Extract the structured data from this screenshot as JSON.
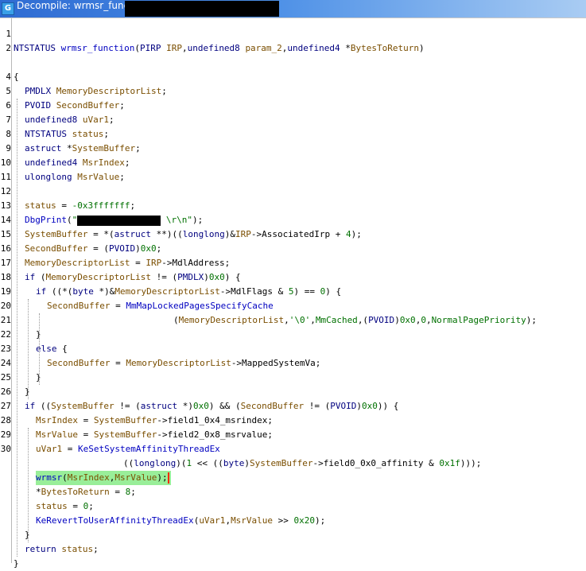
{
  "window": {
    "title": "Decompile: wrmsr_function -",
    "icon": "decompiler-icon",
    "colors": {
      "titlebar": "#2f6bd2",
      "highlight": "#99ee99",
      "keyword": "#00007f",
      "variable": "#7a4e00",
      "function": "#0000c0",
      "number": "#007000"
    }
  },
  "lines": [
    {
      "n": "1",
      "indent": 0,
      "tokens": []
    },
    {
      "n": "2",
      "indent": 0,
      "tokens": [
        [
          "t",
          "NTSTATUS"
        ],
        [
          "p",
          " "
        ],
        [
          "f",
          "wrmsr_function"
        ],
        [
          "p",
          "("
        ],
        [
          "t",
          "PIRP"
        ],
        [
          "p",
          " "
        ],
        [
          "v",
          "IRP"
        ],
        [
          "p",
          ","
        ],
        [
          "t",
          "undefined8"
        ],
        [
          "p",
          " "
        ],
        [
          "v",
          "param_2"
        ],
        [
          "p",
          ","
        ],
        [
          "t",
          "undefined4"
        ],
        [
          "p",
          " *"
        ],
        [
          "v",
          "BytesToReturn"
        ],
        [
          "p",
          ")"
        ]
      ]
    },
    {
      "n": "",
      "indent": 0,
      "tokens": []
    },
    {
      "n": "4",
      "indent": 0,
      "tokens": [
        [
          "p",
          "{"
        ]
      ]
    },
    {
      "n": "5",
      "indent": 1,
      "tokens": [
        [
          "t",
          "PMDLX"
        ],
        [
          "p",
          " "
        ],
        [
          "v",
          "MemoryDescriptorList"
        ],
        [
          "p",
          ";"
        ]
      ]
    },
    {
      "n": "6",
      "indent": 1,
      "tokens": [
        [
          "t",
          "PVOID"
        ],
        [
          "p",
          " "
        ],
        [
          "v",
          "SecondBuffer"
        ],
        [
          "p",
          ";"
        ]
      ]
    },
    {
      "n": "7",
      "indent": 1,
      "tokens": [
        [
          "t",
          "undefined8"
        ],
        [
          "p",
          " "
        ],
        [
          "v",
          "uVar1"
        ],
        [
          "p",
          ";"
        ]
      ]
    },
    {
      "n": "8",
      "indent": 1,
      "tokens": [
        [
          "t",
          "NTSTATUS"
        ],
        [
          "p",
          " "
        ],
        [
          "v",
          "status"
        ],
        [
          "p",
          ";"
        ]
      ]
    },
    {
      "n": "9",
      "indent": 1,
      "tokens": [
        [
          "t",
          "astruct"
        ],
        [
          "p",
          " *"
        ],
        [
          "v",
          "SystemBuffer"
        ],
        [
          "p",
          ";"
        ]
      ]
    },
    {
      "n": "10",
      "indent": 1,
      "tokens": [
        [
          "t",
          "undefined4"
        ],
        [
          "p",
          " "
        ],
        [
          "v",
          "MsrIndex"
        ],
        [
          "p",
          ";"
        ]
      ]
    },
    {
      "n": "11",
      "indent": 1,
      "tokens": [
        [
          "t",
          "ulonglong"
        ],
        [
          "p",
          " "
        ],
        [
          "v",
          "MsrValue"
        ],
        [
          "p",
          ";"
        ]
      ]
    },
    {
      "n": "12",
      "indent": 1,
      "tokens": []
    },
    {
      "n": "13",
      "indent": 1,
      "tokens": [
        [
          "v",
          "status"
        ],
        [
          "p",
          " = "
        ],
        [
          "n",
          "-0x3fffffff"
        ],
        [
          "p",
          ";"
        ]
      ]
    },
    {
      "n": "14",
      "indent": 1,
      "tokens": [
        [
          "f",
          "DbgPrint"
        ],
        [
          "p",
          "("
        ],
        [
          "s",
          "\""
        ],
        [
          "r",
          ""
        ],
        [
          "s",
          " \\r\\n\""
        ],
        [
          "p",
          ");"
        ]
      ]
    },
    {
      "n": "15",
      "indent": 1,
      "tokens": [
        [
          "v",
          "SystemBuffer"
        ],
        [
          "p",
          " = *("
        ],
        [
          "t",
          "astruct"
        ],
        [
          "p",
          " **)(("
        ],
        [
          "t",
          "longlong"
        ],
        [
          "p",
          ")&"
        ],
        [
          "v",
          "IRP"
        ],
        [
          "p",
          "->AssociatedIrp + "
        ],
        [
          "n",
          "4"
        ],
        [
          "p",
          ");"
        ]
      ]
    },
    {
      "n": "16",
      "indent": 1,
      "tokens": [
        [
          "v",
          "SecondBuffer"
        ],
        [
          "p",
          " = ("
        ],
        [
          "t",
          "PVOID"
        ],
        [
          "p",
          ")"
        ],
        [
          "n",
          "0x0"
        ],
        [
          "p",
          ";"
        ]
      ]
    },
    {
      "n": "17",
      "indent": 1,
      "tokens": [
        [
          "v",
          "MemoryDescriptorList"
        ],
        [
          "p",
          " = "
        ],
        [
          "v",
          "IRP"
        ],
        [
          "p",
          "->MdlAddress;"
        ]
      ]
    },
    {
      "n": "18",
      "indent": 1,
      "tokens": [
        [
          "k",
          "if"
        ],
        [
          "p",
          " ("
        ],
        [
          "v",
          "MemoryDescriptorList"
        ],
        [
          "p",
          " != ("
        ],
        [
          "t",
          "PMDLX"
        ],
        [
          "p",
          ")"
        ],
        [
          "n",
          "0x0"
        ],
        [
          "p",
          ") {"
        ]
      ]
    },
    {
      "n": "19",
      "indent": 2,
      "tokens": [
        [
          "k",
          "if"
        ],
        [
          "p",
          " ((*("
        ],
        [
          "t",
          "byte"
        ],
        [
          "p",
          " *)&"
        ],
        [
          "v",
          "MemoryDescriptorList"
        ],
        [
          "p",
          "->MdlFlags & "
        ],
        [
          "n",
          "5"
        ],
        [
          "p",
          ") == "
        ],
        [
          "n",
          "0"
        ],
        [
          "p",
          ") {"
        ]
      ]
    },
    {
      "n": "20",
      "indent": 3,
      "tokens": [
        [
          "v",
          "SecondBuffer"
        ],
        [
          "p",
          " = "
        ],
        [
          "f",
          "MmMapLockedPagesSpecifyCache"
        ]
      ]
    },
    {
      "n": "21",
      "indent": 0,
      "pad": 218,
      "tokens": [
        [
          "p",
          "("
        ],
        [
          "v",
          "MemoryDescriptorList"
        ],
        [
          "p",
          ","
        ],
        [
          "s",
          "'\\0'"
        ],
        [
          "p",
          ","
        ],
        [
          "n",
          "MmCached"
        ],
        [
          "p",
          ",("
        ],
        [
          "t",
          "PVOID"
        ],
        [
          "p",
          ")"
        ],
        [
          "n",
          "0x0"
        ],
        [
          "p",
          ","
        ],
        [
          "n",
          "0"
        ],
        [
          "p",
          ","
        ],
        [
          "n",
          "NormalPagePriority"
        ],
        [
          "p",
          ");"
        ]
      ]
    },
    {
      "n": "22",
      "indent": 2,
      "tokens": [
        [
          "p",
          "}"
        ]
      ]
    },
    {
      "n": "23",
      "indent": 2,
      "tokens": [
        [
          "k",
          "else"
        ],
        [
          "p",
          " {"
        ]
      ]
    },
    {
      "n": "24",
      "indent": 3,
      "tokens": [
        [
          "v",
          "SecondBuffer"
        ],
        [
          "p",
          " = "
        ],
        [
          "v",
          "MemoryDescriptorList"
        ],
        [
          "p",
          "->MappedSystemVa;"
        ]
      ]
    },
    {
      "n": "25",
      "indent": 2,
      "tokens": [
        [
          "p",
          "}"
        ]
      ]
    },
    {
      "n": "26",
      "indent": 1,
      "tokens": [
        [
          "p",
          "}"
        ]
      ]
    },
    {
      "n": "27",
      "indent": 1,
      "tokens": [
        [
          "k",
          "if"
        ],
        [
          "p",
          " (("
        ],
        [
          "v",
          "SystemBuffer"
        ],
        [
          "p",
          " != ("
        ],
        [
          "t",
          "astruct"
        ],
        [
          "p",
          " *)"
        ],
        [
          "n",
          "0x0"
        ],
        [
          "p",
          ") && ("
        ],
        [
          "v",
          "SecondBuffer"
        ],
        [
          "p",
          " != ("
        ],
        [
          "t",
          "PVOID"
        ],
        [
          "p",
          ")"
        ],
        [
          "n",
          "0x0"
        ],
        [
          "p",
          ")) {"
        ]
      ]
    },
    {
      "n": "28",
      "indent": 2,
      "tokens": [
        [
          "v",
          "MsrIndex"
        ],
        [
          "p",
          " = "
        ],
        [
          "v",
          "SystemBuffer"
        ],
        [
          "p",
          "->field1_0x4_msrindex;"
        ]
      ]
    },
    {
      "n": "29",
      "indent": 2,
      "tokens": [
        [
          "v",
          "MsrValue"
        ],
        [
          "p",
          " = "
        ],
        [
          "v",
          "SystemBuffer"
        ],
        [
          "p",
          "->field2_0x8_msrvalue;"
        ]
      ]
    },
    {
      "n": "30",
      "indent": 2,
      "tokens": [
        [
          "v",
          "uVar1"
        ],
        [
          "p",
          " = "
        ],
        [
          "f",
          "KeSetSystemAffinityThreadEx"
        ]
      ]
    },
    {
      "n": "",
      "indent": 0,
      "pad": 155,
      "tokens": [
        [
          "p",
          "(("
        ],
        [
          "t",
          "longlong"
        ],
        [
          "p",
          ")("
        ],
        [
          "n",
          "1"
        ],
        [
          "p",
          " << (("
        ],
        [
          "t",
          "byte"
        ],
        [
          "p",
          ")"
        ],
        [
          "v",
          "SystemBuffer"
        ],
        [
          "p",
          "->field0_0x0_affinity & "
        ],
        [
          "n",
          "0x1f"
        ],
        [
          "p",
          ")));"
        ]
      ]
    },
    {
      "n": "",
      "indent": 2,
      "hl": true,
      "tokens": [
        [
          "f",
          "wrmsr"
        ],
        [
          "p",
          "("
        ],
        [
          "v",
          "MsrIndex"
        ],
        [
          "p",
          ","
        ],
        [
          "v",
          "MsrValue"
        ],
        [
          "p",
          ");"
        ],
        [
          "c",
          ""
        ]
      ]
    },
    {
      "n": "",
      "indent": 2,
      "tokens": [
        [
          "p",
          "*"
        ],
        [
          "v",
          "BytesToReturn"
        ],
        [
          "p",
          " = "
        ],
        [
          "n",
          "8"
        ],
        [
          "p",
          ";"
        ]
      ]
    },
    {
      "n": "",
      "indent": 2,
      "tokens": [
        [
          "v",
          "status"
        ],
        [
          "p",
          " = "
        ],
        [
          "n",
          "0"
        ],
        [
          "p",
          ";"
        ]
      ]
    },
    {
      "n": "",
      "indent": 2,
      "tokens": [
        [
          "f",
          "KeRevertToUserAffinityThreadEx"
        ],
        [
          "p",
          "("
        ],
        [
          "v",
          "uVar1"
        ],
        [
          "p",
          ","
        ],
        [
          "v",
          "MsrValue"
        ],
        [
          "p",
          " >> "
        ],
        [
          "n",
          "0x20"
        ],
        [
          "p",
          ");"
        ]
      ]
    },
    {
      "n": "",
      "indent": 1,
      "tokens": [
        [
          "p",
          "}"
        ]
      ]
    },
    {
      "n": "",
      "indent": 1,
      "tokens": [
        [
          "k",
          "return"
        ],
        [
          "p",
          " "
        ],
        [
          "v",
          "status"
        ],
        [
          "p",
          ";"
        ]
      ]
    },
    {
      "n": "",
      "indent": 0,
      "tokens": [
        [
          "p",
          "}"
        ]
      ]
    }
  ]
}
